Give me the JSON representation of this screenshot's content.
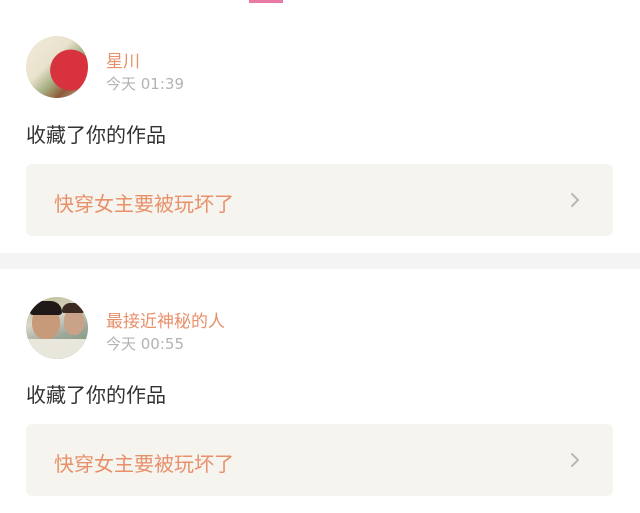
{
  "notifications": [
    {
      "username": "星川",
      "time": "今天 01:39",
      "action": "收藏了你的作品",
      "work_title": "快穿女主要被玩坏了",
      "avatar_icon": "avatar-red-object"
    },
    {
      "username": "最接近神秘的人",
      "time": "今天 00:55",
      "action": "收藏了你的作品",
      "work_title": "快穿女主要被玩坏了",
      "avatar_icon": "avatar-two-people"
    }
  ],
  "colors": {
    "username": "#e8906a",
    "time": "#b3b3b3",
    "action": "#333333",
    "box_bg": "#f5f4ef",
    "divider": "#f4f4f4",
    "tab_indicator": "#e87aa5"
  }
}
